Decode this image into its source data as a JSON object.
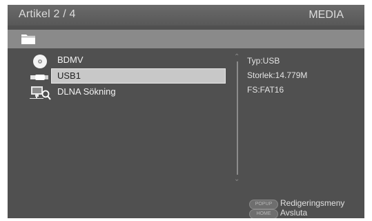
{
  "header": {
    "title": "Artikel 2 / 4",
    "source": "MEDIA"
  },
  "list": {
    "items": [
      {
        "label": "BDMV",
        "icon": "disc-icon"
      },
      {
        "label": "USB1",
        "icon": "usb-icon"
      },
      {
        "label": "DLNA Sökning",
        "icon": "dlna-search-icon"
      }
    ]
  },
  "info": {
    "type": "Typ:USB",
    "size": "Storlek:14.779M",
    "fs": "FS:FAT16"
  },
  "hints": [
    {
      "key": "POPUP",
      "label": "Redigeringsmeny"
    },
    {
      "key": "HOME",
      "label": "Avsluta"
    }
  ],
  "colors": {
    "background": "#505050",
    "selection": "#c8c8c8",
    "pathbar": "#8a8a8a"
  }
}
